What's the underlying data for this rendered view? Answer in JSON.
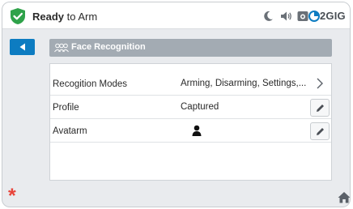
{
  "status": {
    "state_bold": "Ready",
    "state_rest": " to Arm",
    "brand": "2GIG",
    "icons": [
      "shield-check-icon",
      "moon-icon",
      "speaker-icon",
      "camera-icon",
      "brand-logo-icon"
    ],
    "shield_color": "#2fa24a"
  },
  "header": {
    "title": "Face Recognition",
    "icon": "faces-icon"
  },
  "rows": [
    {
      "label": "Recogition Modes",
      "value": "Arming, Disarming, Settings,...",
      "action": "chevron-right-icon"
    },
    {
      "label": "Profile",
      "value": "Captured",
      "action": "edit-icon"
    },
    {
      "label": "Avatarm",
      "value": "",
      "value_icon": "person-icon",
      "action": "edit-icon"
    }
  ],
  "footer": {
    "emergency_symbol": "*",
    "home_icon": "home-icon"
  },
  "colors": {
    "accent": "#0d7cc1",
    "header": "#a3abb3",
    "emergency": "#e8443a"
  }
}
